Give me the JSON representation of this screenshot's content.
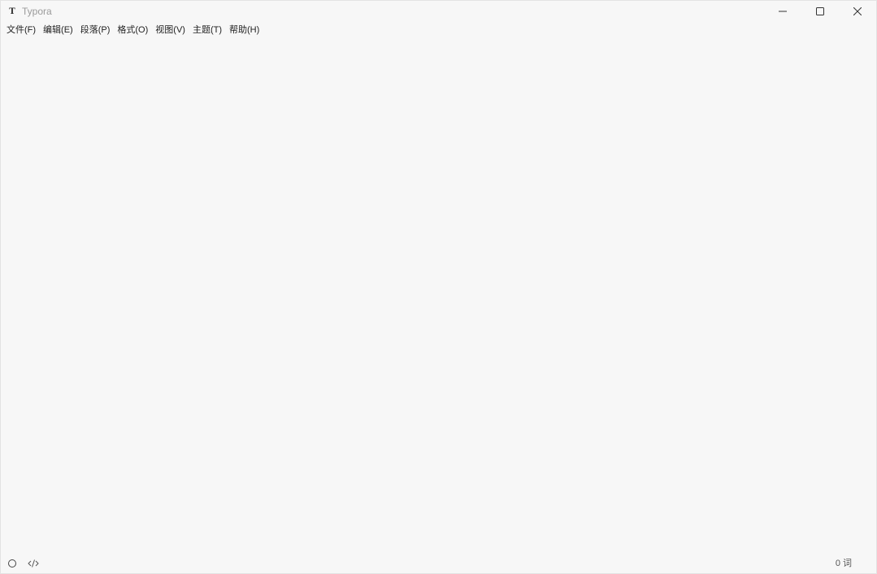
{
  "window": {
    "app_icon_glyph": "T",
    "title": "Typora",
    "controls": {
      "minimize_icon": "minimize-icon",
      "maximize_icon": "maximize-icon",
      "close_icon": "close-icon"
    }
  },
  "menubar": {
    "items": [
      {
        "label": "文件(F)"
      },
      {
        "label": "编辑(E)"
      },
      {
        "label": "段落(P)"
      },
      {
        "label": "格式(O)"
      },
      {
        "label": "视图(V)"
      },
      {
        "label": "主题(T)"
      },
      {
        "label": "帮助(H)"
      }
    ]
  },
  "editor": {
    "content": ""
  },
  "statusbar": {
    "sidebar_toggle_icon": "circle-icon",
    "source_mode_icon": "code-icon",
    "word_count": "0 词"
  },
  "colors": {
    "background": "#f7f7f7",
    "title_text": "#9a9a9a",
    "menu_text": "#222222"
  }
}
